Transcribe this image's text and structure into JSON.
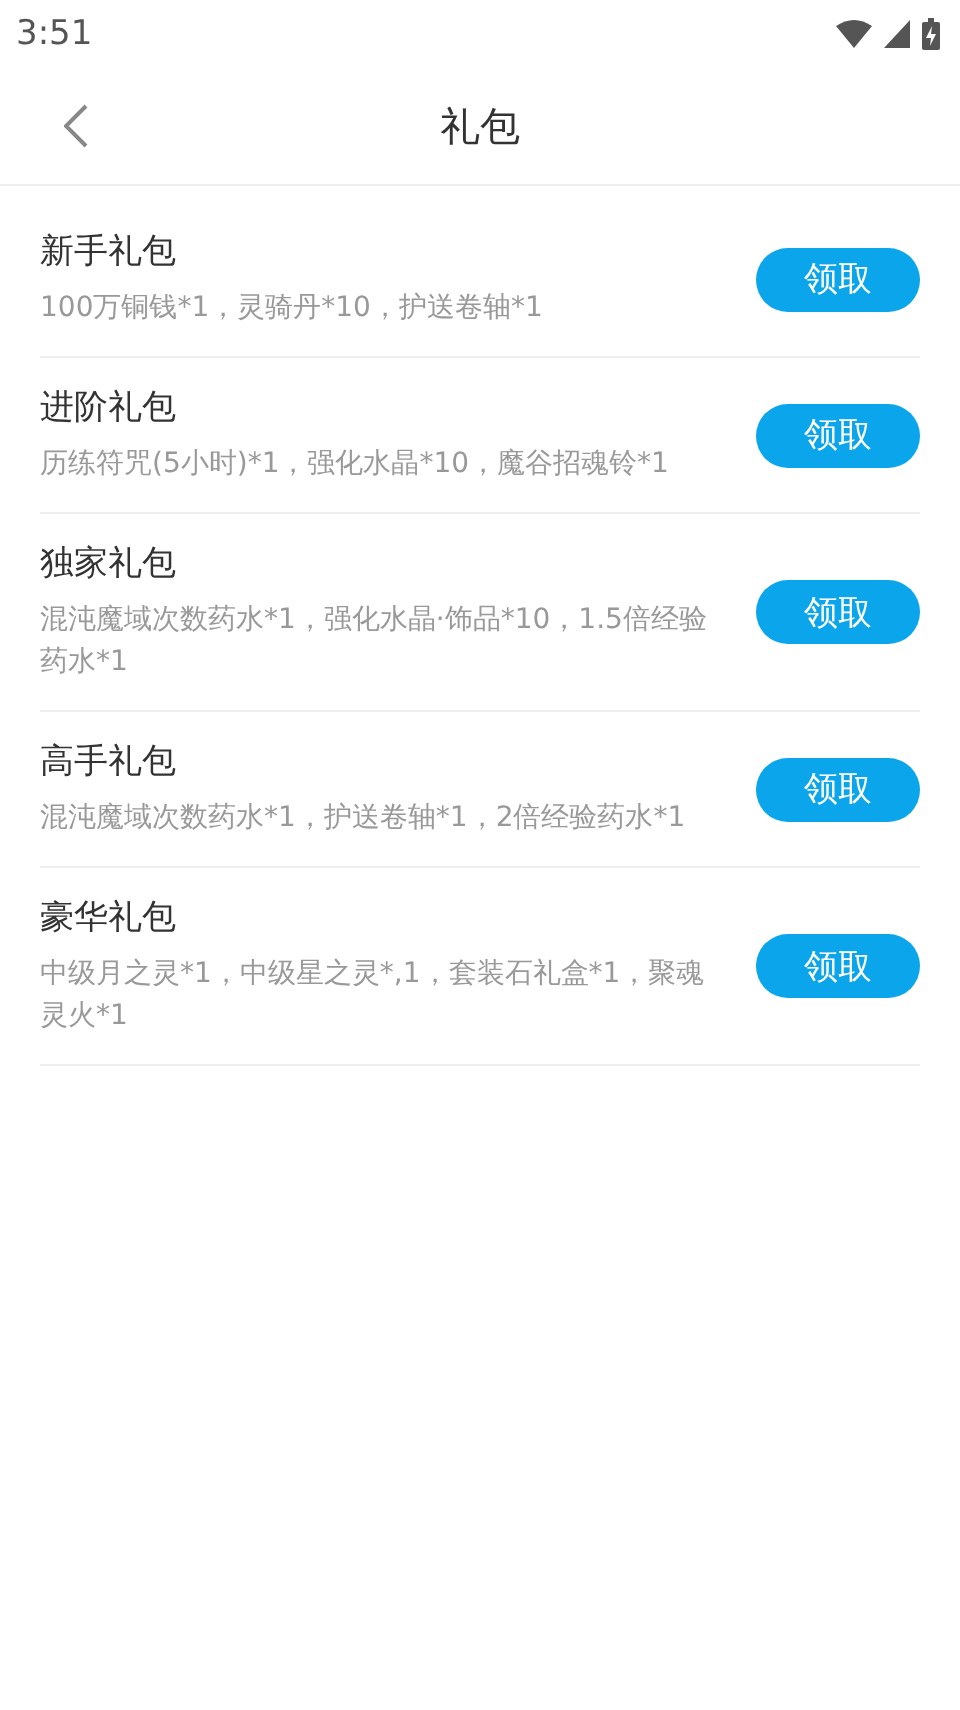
{
  "status_bar": {
    "time": "3:51"
  },
  "header": {
    "title": "礼包"
  },
  "packages": [
    {
      "name": "新手礼包",
      "contents": "100万铜钱*1，灵骑丹*10，护送卷轴*1",
      "button": "领取"
    },
    {
      "name": "进阶礼包",
      "contents": "历练符咒(5小时)*1，强化水晶*10，魔谷招魂铃*1",
      "button": "领取"
    },
    {
      "name": "独家礼包",
      "contents": "混沌魔域次数药水*1，强化水晶·饰品*10，1.5倍经验药水*1",
      "button": "领取"
    },
    {
      "name": "高手礼包",
      "contents": "混沌魔域次数药水*1，护送卷轴*1，2倍经验药水*1",
      "button": "领取"
    },
    {
      "name": "豪华礼包",
      "contents": "中级月之灵*1，中级星之灵*,1，套装石礼盒*1，聚魂灵火*1",
      "button": "领取"
    }
  ]
}
